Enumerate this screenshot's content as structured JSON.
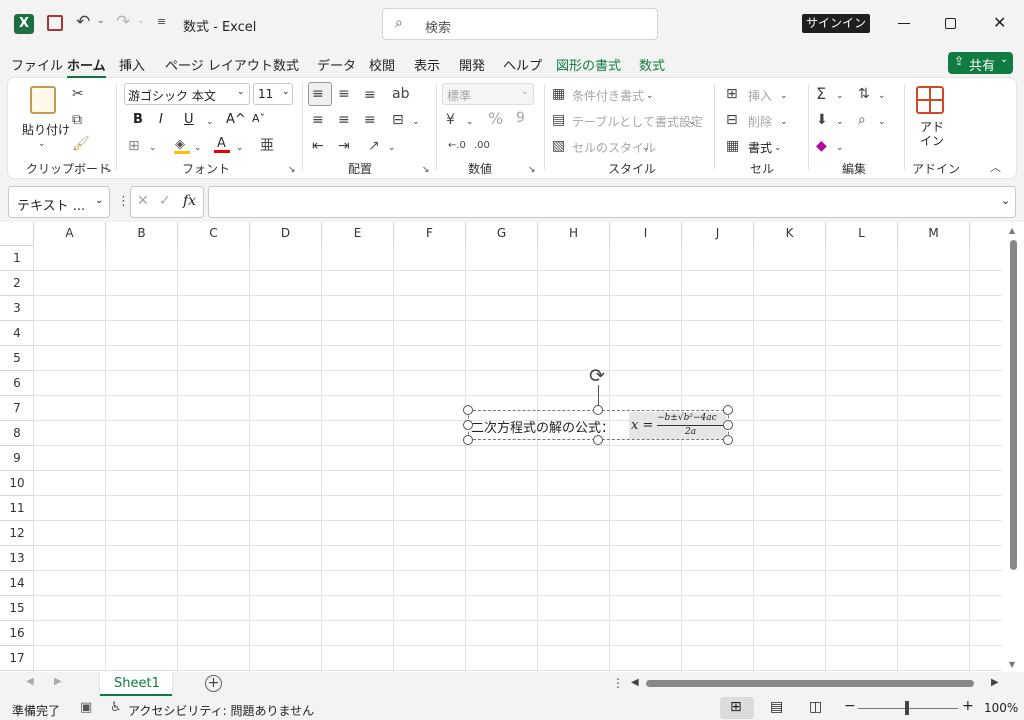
{
  "titlebar": {
    "doc_title": "数式 - Excel",
    "search_placeholder": "検索",
    "signin_label": "サインイン"
  },
  "tabs": [
    "ファイル",
    "ホーム",
    "挿入",
    "ページ レイアウト",
    "数式",
    "データ",
    "校閲",
    "表示",
    "開発",
    "ヘルプ",
    "図形の書式",
    "数式"
  ],
  "share_label": "共有",
  "ribbon": {
    "clipboard": {
      "paste": "貼り付け",
      "label": "クリップボード"
    },
    "font": {
      "name": "游ゴシック 本文",
      "size": "11",
      "bold": "B",
      "italic": "I",
      "underline": "U",
      "grow": "A^",
      "shrink": "Aˇ",
      "label": "フォント"
    },
    "alignment": {
      "label": "配置"
    },
    "number": {
      "format": "標準",
      "percent": "%",
      "comma": "9",
      "label": "数値"
    },
    "styles": {
      "cond": "条件付き書式",
      "table": "テーブルとして書式設定",
      "cell": "セルのスタイル",
      "label": "スタイル"
    },
    "cells": {
      "insert": "挿入",
      "delete": "削除",
      "format": "書式",
      "label": "セル"
    },
    "editing": {
      "label": "編集"
    },
    "addins": {
      "btn": "アド\nイン",
      "label": "アドイン"
    }
  },
  "formula_bar": {
    "name_box": "テキスト ...",
    "fx": "fx",
    "content": ""
  },
  "columns": [
    "A",
    "B",
    "C",
    "D",
    "E",
    "F",
    "G",
    "H",
    "I",
    "J",
    "K",
    "L",
    "M"
  ],
  "rows": [
    "1",
    "2",
    "3",
    "4",
    "5",
    "6",
    "7",
    "8",
    "9",
    "10",
    "11",
    "12",
    "13",
    "14",
    "15",
    "16",
    "17"
  ],
  "textbox": {
    "text": "二次方程式の解の公式：",
    "eq_lhs": "x =",
    "eq_num": "−b±√b²−4ac",
    "eq_den": "2a"
  },
  "sheets": [
    "Sheet1"
  ],
  "status": {
    "ready": "準備完了",
    "accessibility": "アクセシビリティ: 問題ありません",
    "zoom": "100%"
  },
  "colors": {
    "accent": "#107c41",
    "excel_green": "#1d6f42",
    "share_bg": "#107c41"
  }
}
